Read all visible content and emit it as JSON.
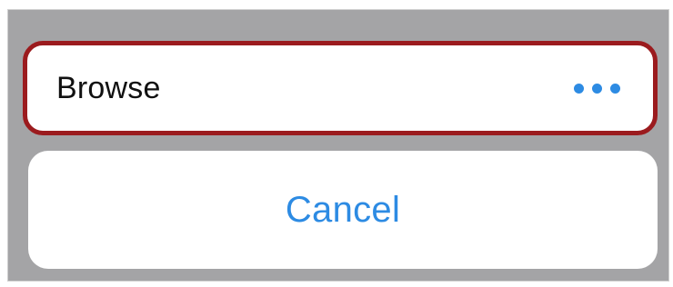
{
  "action_sheet": {
    "browse_label": "Browse",
    "more_icon": "more-horizontal-icon",
    "cancel_label": "Cancel"
  },
  "colors": {
    "highlight_border": "#9b1b1e",
    "accent_blue": "#2d8be3",
    "overlay_gray": "#a4a4a6"
  }
}
